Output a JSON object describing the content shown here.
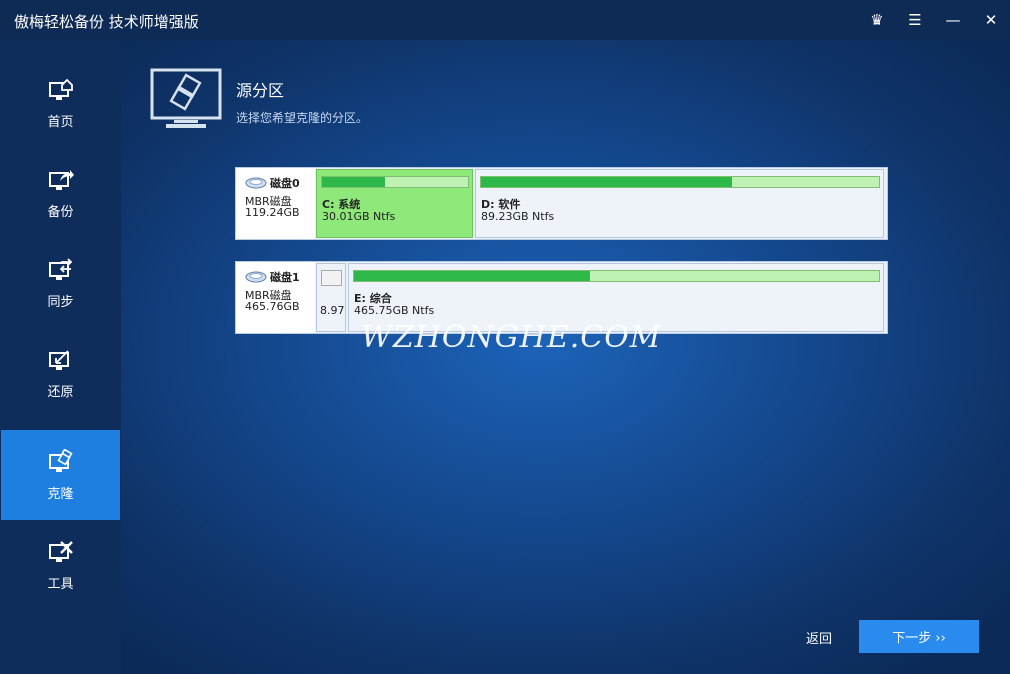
{
  "window": {
    "title": "傲梅轻松备份 技术师增强版",
    "controls": [
      {
        "name": "crown-icon",
        "glyph": "♛"
      },
      {
        "name": "menu-icon",
        "glyph": "☰"
      },
      {
        "name": "minimize-icon",
        "glyph": "—"
      },
      {
        "name": "close-icon",
        "glyph": "✕"
      }
    ]
  },
  "sidebar": {
    "items": [
      {
        "label": "首页",
        "icon": "home-monitor-icon"
      },
      {
        "label": "备份",
        "icon": "backup-monitor-icon"
      },
      {
        "label": "同步",
        "icon": "sync-monitor-icon"
      },
      {
        "label": "还原",
        "icon": "restore-monitor-icon"
      },
      {
        "label": "克隆",
        "icon": "clone-monitor-icon",
        "active": true
      },
      {
        "label": "工具",
        "icon": "tools-monitor-icon"
      }
    ]
  },
  "main": {
    "title": "源分区",
    "subtitle": "选择您希望克隆的分区。",
    "disks": [
      {
        "name": "磁盘0",
        "type": "MBR磁盘",
        "size": "119.24GB",
        "partitions": [
          {
            "label": "C: 系统",
            "size": "30.01GB Ntfs",
            "used": 0.43,
            "selected": true
          },
          {
            "label": "D: 软件",
            "size": "89.23GB Ntfs",
            "used": 0.63,
            "selected": false
          }
        ]
      },
      {
        "name": "磁盘1",
        "type": "MBR磁盘",
        "size": "465.76GB",
        "partitions": [
          {
            "label": "",
            "size": "8.97",
            "used": 0.0,
            "selected": false
          },
          {
            "label": "E: 综合",
            "size": "465.75GB Ntfs",
            "used": 0.45,
            "selected": false
          }
        ]
      }
    ],
    "watermark": "WZHONGHE.COM"
  },
  "footer": {
    "back_label": "返回",
    "next_label": "下一步 ››"
  },
  "colors": {
    "accent": "#1f7fe0",
    "selected_partition": "#8ee87a",
    "used_fill": "#2fb84a"
  }
}
